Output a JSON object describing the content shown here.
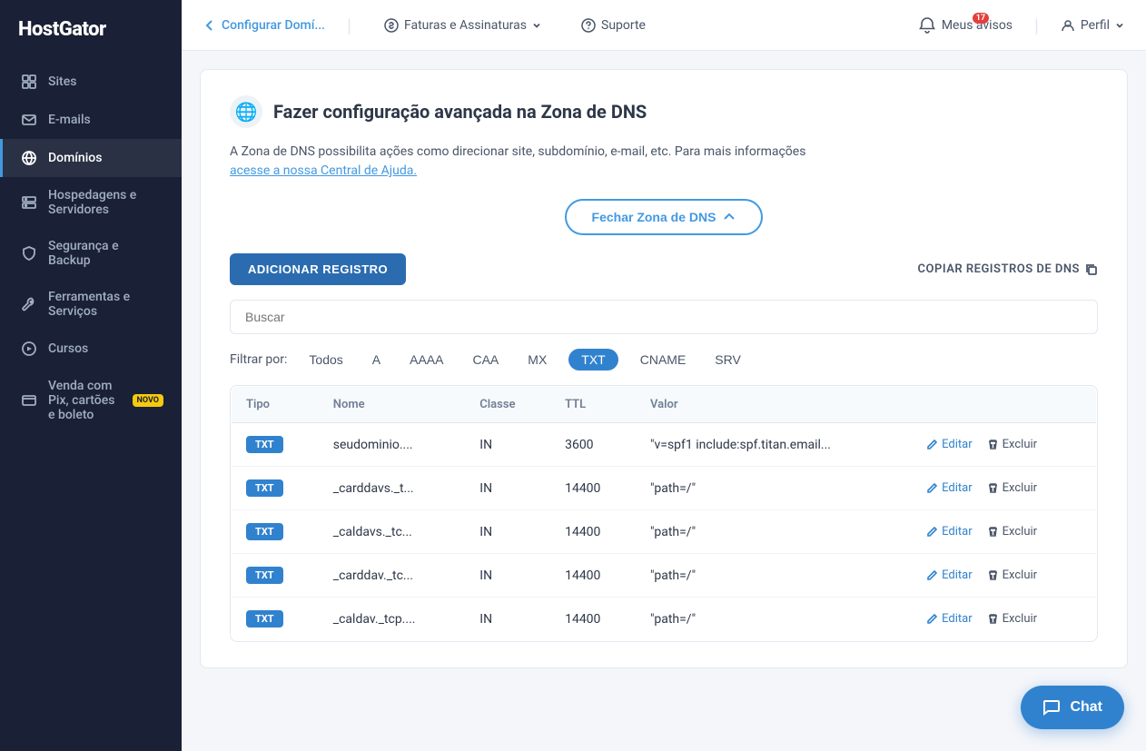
{
  "app": {
    "name": "HostGator"
  },
  "sidebar": {
    "items": [
      {
        "id": "sites",
        "label": "Sites",
        "icon": "grid"
      },
      {
        "id": "emails",
        "label": "E-mails",
        "icon": "mail"
      },
      {
        "id": "domains",
        "label": "Domínios",
        "icon": "globe",
        "active": true
      },
      {
        "id": "hosting",
        "label": "Hospedagens e Servidores",
        "icon": "server"
      },
      {
        "id": "security",
        "label": "Segurança e Backup",
        "icon": "shield"
      },
      {
        "id": "tools",
        "label": "Ferramentas e Serviços",
        "icon": "tool"
      },
      {
        "id": "courses",
        "label": "Cursos",
        "icon": "play"
      },
      {
        "id": "pix",
        "label": "Venda com Pix, cartões e boleto",
        "icon": "credit-card",
        "badge": "NOVO"
      }
    ]
  },
  "header": {
    "back_label": "Configurar Domí...",
    "billing_label": "Faturas e Assinaturas",
    "support_label": "Suporte",
    "notifications_label": "Meus avisos",
    "notifications_count": "17",
    "profile_label": "Perfil"
  },
  "dns_zone": {
    "title": "Fazer configuração avançada na Zona de DNS",
    "description": "A Zona de DNS possibilita ações como direcionar site, subdomínio, e-mail, etc. Para mais informações",
    "help_link": "acesse a nossa Central de Ajuda.",
    "close_btn": "Fechar Zona de DNS",
    "add_record_btn": "ADICIONAR REGISTRO",
    "copy_records_label": "COPIAR REGISTROS DE DNS",
    "search_placeholder": "Buscar",
    "filter_label": "Filtrar por:",
    "filters": [
      "Todos",
      "A",
      "AAAA",
      "CAA",
      "MX",
      "TXT",
      "CNAME",
      "SRV"
    ],
    "active_filter": "TXT",
    "table_headers": [
      "Tipo",
      "Nome",
      "Classe",
      "TTL",
      "Valor"
    ],
    "records": [
      {
        "type": "TXT",
        "name": "seudominio....",
        "class": "IN",
        "ttl": "3600",
        "value": "\"v=spf1 include:spf.titan.email...",
        "edit": "Editar",
        "delete": "Excluir"
      },
      {
        "type": "TXT",
        "name": "_carddavs._t...",
        "class": "IN",
        "ttl": "14400",
        "value": "\"path=/\"",
        "edit": "Editar",
        "delete": "Excluir"
      },
      {
        "type": "TXT",
        "name": "_caldavs._tc...",
        "class": "IN",
        "ttl": "14400",
        "value": "\"path=/\"",
        "edit": "Editar",
        "delete": "Excluir"
      },
      {
        "type": "TXT",
        "name": "_carddav._tc...",
        "class": "IN",
        "ttl": "14400",
        "value": "\"path=/\"",
        "edit": "Editar",
        "delete": "Excluir"
      },
      {
        "type": "TXT",
        "name": "_caldav._tcp....",
        "class": "IN",
        "ttl": "14400",
        "value": "\"path=/\"",
        "edit": "Editar",
        "delete": "Excluir"
      }
    ]
  },
  "chat": {
    "label": "Chat"
  }
}
